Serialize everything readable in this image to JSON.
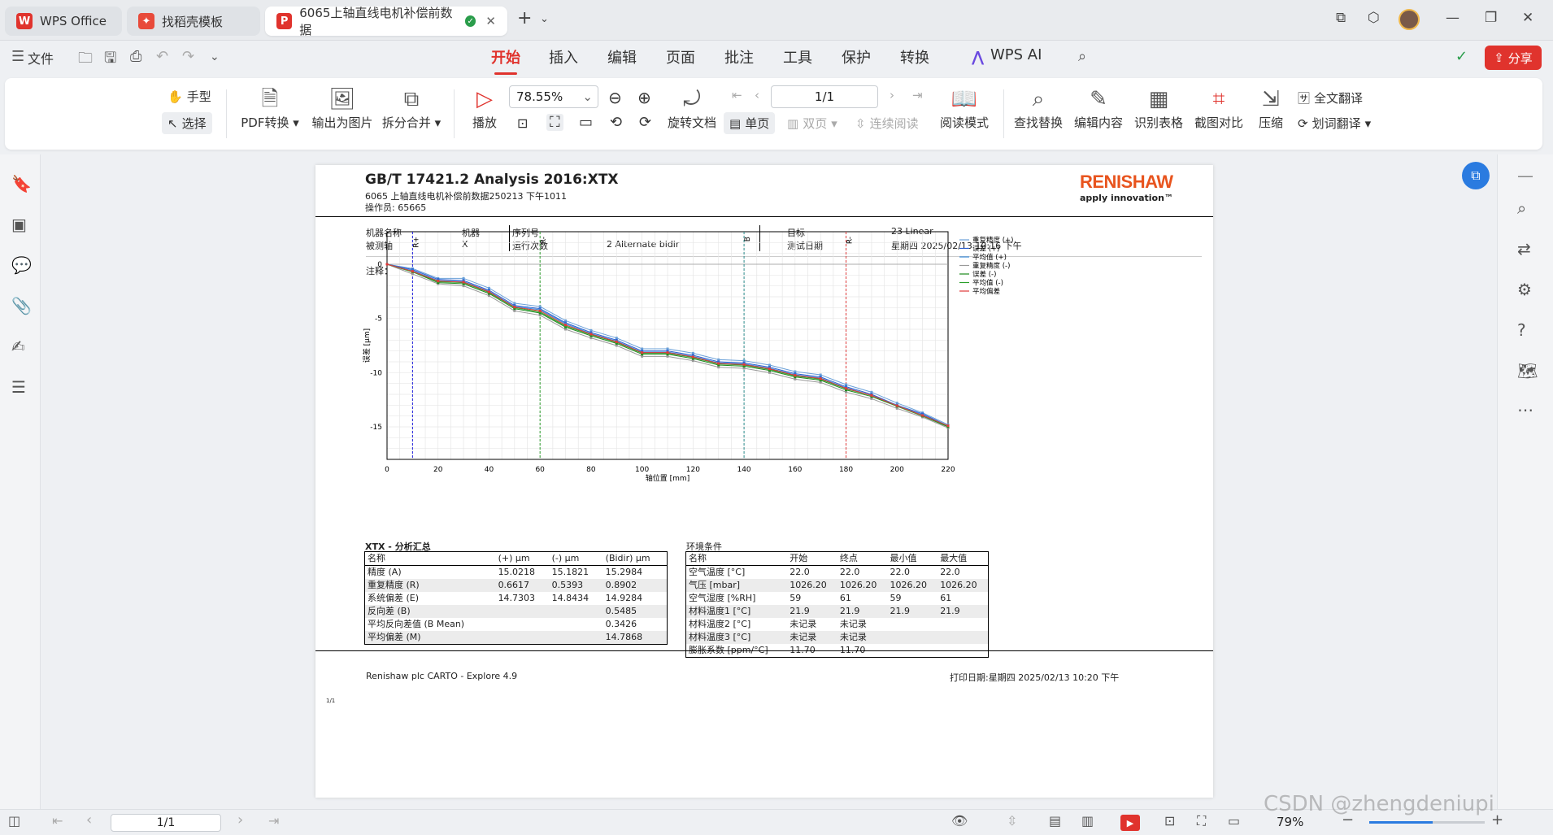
{
  "tabs": [
    {
      "label": "WPS Office",
      "icon": "wps-logo-icon"
    },
    {
      "label": "找稻壳模板",
      "icon": "docer-icon"
    },
    {
      "label": "6065上轴直线电机补偿前数据",
      "icon": "pdf-icon"
    }
  ],
  "menu": {
    "file": "文件",
    "items": [
      "开始",
      "插入",
      "编辑",
      "页面",
      "批注",
      "工具",
      "保护",
      "转换"
    ],
    "active": "开始",
    "wps_ai": "WPS AI",
    "share": "分享"
  },
  "ribbon": {
    "hand": "手型",
    "select": "选择",
    "pdf_convert": "PDF转换",
    "export_image": "输出为图片",
    "split_merge": "拆分合并",
    "play": "播放",
    "zoom": "78.55%",
    "page": "1/1",
    "rotate": "旋转文档",
    "single": "单页",
    "double": "双页",
    "continuous": "连续阅读",
    "reading": "阅读模式",
    "find_replace": "查找替换",
    "edit_content": "编辑内容",
    "recognize_table": "识别表格",
    "screenshot_compare": "截图对比",
    "compress": "压缩",
    "full_translate": "全文翻译",
    "word_translate": "划词翻译"
  },
  "status": {
    "page": "1/1",
    "zoom": "79%",
    "watermark": "CSDN @zhengdeniupi"
  },
  "report": {
    "title": "GB/T 17421.2 Analysis 2016:XTX",
    "sub1": "6065 上轴直线电机补偿前数据250213 下午1011",
    "sub2": "操作员: 65665",
    "brand": "RENISHAW",
    "tagline": "apply innovation™",
    "info": {
      "machine_k": "机器名称",
      "machine_v": "机器",
      "axis_k": "被测轴",
      "axis_v": "X",
      "serial_k": "序列号",
      "serial_v": "-",
      "runs_k": "运行次数",
      "runs_v": "2 Alternate bidir",
      "target_k": "目标",
      "target_v": "23 Linear",
      "date_k": "测试日期",
      "date_v": "星期四 2025/02/13 10:16 下午"
    },
    "notes": "注释：",
    "table1": {
      "title": "XTX - 分析汇总",
      "head": [
        "名称",
        "(+) µm",
        "(-) µm",
        "(Bidir) µm"
      ],
      "rows": [
        [
          "精度 (A)",
          "15.0218",
          "15.1821",
          "15.2984"
        ],
        [
          "重复精度 (R)",
          "0.6617",
          "0.5393",
          "0.8902"
        ],
        [
          "系统偏差 (E)",
          "14.7303",
          "14.8434",
          "14.9284"
        ],
        [
          "反向差 (B)",
          "",
          "",
          "0.5485"
        ],
        [
          "平均反向差值 (B Mean)",
          "",
          "",
          "0.3426"
        ],
        [
          "平均偏差 (M)",
          "",
          "",
          "14.7868"
        ]
      ]
    },
    "table2": {
      "title": "环境条件",
      "head": [
        "名称",
        "开始",
        "终点",
        "最小值",
        "最大值"
      ],
      "rows": [
        [
          "空气温度 [°C]",
          "22.0",
          "22.0",
          "22.0",
          "22.0"
        ],
        [
          "气压 [mbar]",
          "1026.20",
          "1026.20",
          "1026.20",
          "1026.20"
        ],
        [
          "空气湿度 [%RH]",
          "59",
          "61",
          "59",
          "61"
        ],
        [
          "材料温度1 [°C]",
          "21.9",
          "21.9",
          "21.9",
          "21.9"
        ],
        [
          "材料温度2 [°C]",
          "未记录",
          "未记录",
          "",
          ""
        ],
        [
          "材料温度3 [°C]",
          "未记录",
          "未记录",
          "",
          ""
        ],
        [
          "膨胀系数 [ppm/°C]",
          "11.70",
          "11.70",
          "",
          ""
        ]
      ]
    },
    "footer_left": "Renishaw plc CARTO - Explore 4.9",
    "footer_right": "打印日期:星期四 2025/02/13 10:20 下午",
    "page_no": "1/1"
  },
  "chart_data": {
    "type": "line",
    "xlabel": "轴位置 [mm]",
    "ylabel": "误差 [µm]",
    "xlim": [
      0,
      220
    ],
    "ylim": [
      -18,
      3
    ],
    "xticks": [
      0,
      20,
      40,
      60,
      80,
      100,
      120,
      140,
      160,
      180,
      200,
      220
    ],
    "yticks": [
      0,
      -5,
      -10,
      -15
    ],
    "x": [
      0,
      10,
      20,
      30,
      40,
      50,
      60,
      70,
      80,
      90,
      100,
      110,
      120,
      130,
      140,
      150,
      160,
      170,
      180,
      190,
      200,
      210,
      220
    ],
    "markers": [
      {
        "label": "R+",
        "x": 10,
        "color": "#1a1adc"
      },
      {
        "label": "R-",
        "x": 60,
        "color": "#2a9a2a"
      },
      {
        "label": "B",
        "x": 140,
        "color": "#2a8a8a"
      },
      {
        "label": "R-",
        "x": 180,
        "color": "#e03a3a"
      }
    ],
    "series": [
      {
        "name": "重复精度 (+)",
        "color": "#6aa0d8",
        "values": [
          0,
          -0.4,
          -1.3,
          -1.3,
          -2.2,
          -3.6,
          -3.9,
          -5.2,
          -6.1,
          -6.8,
          -7.8,
          -7.8,
          -8.2,
          -8.8,
          -8.9,
          -9.3,
          -9.9,
          -10.2,
          -11.1,
          -11.8,
          -12.8,
          -13.7,
          -14.8
        ]
      },
      {
        "name": "误差 (+)",
        "color": "#2a5fd0",
        "values": [
          0,
          -0.5,
          -1.4,
          -1.5,
          -2.4,
          -3.8,
          -4.1,
          -5.4,
          -6.3,
          -7.0,
          -8.0,
          -8.0,
          -8.4,
          -9.0,
          -9.1,
          -9.5,
          -10.1,
          -10.4,
          -11.3,
          -12.0,
          -13.0,
          -13.8,
          -14.9
        ]
      },
      {
        "name": "平均值 (+)",
        "color": "#3a8ad8",
        "values": [
          0,
          -0.6,
          -1.5,
          -1.6,
          -2.5,
          -3.9,
          -4.2,
          -5.5,
          -6.4,
          -7.1,
          -8.1,
          -8.1,
          -8.5,
          -9.1,
          -9.2,
          -9.6,
          -10.2,
          -10.5,
          -11.4,
          -12.1,
          -13.0,
          -13.9,
          -14.9
        ]
      },
      {
        "name": "重复精度 (-)",
        "color": "#999999",
        "values": [
          0,
          -0.9,
          -1.8,
          -2.0,
          -2.9,
          -4.3,
          -4.7,
          -6.0,
          -6.8,
          -7.5,
          -8.5,
          -8.5,
          -8.9,
          -9.5,
          -9.6,
          -10.0,
          -10.6,
          -10.9,
          -11.8,
          -12.4,
          -13.3,
          -14.1,
          -15.1
        ]
      },
      {
        "name": "误差 (-)",
        "color": "#1a8a1a",
        "values": [
          0,
          -0.7,
          -1.7,
          -1.8,
          -2.7,
          -4.1,
          -4.5,
          -5.8,
          -6.6,
          -7.3,
          -8.3,
          -8.3,
          -8.7,
          -9.3,
          -9.4,
          -9.8,
          -10.4,
          -10.7,
          -11.6,
          -12.2,
          -13.1,
          -14.0,
          -15.0
        ]
      },
      {
        "name": "平均值 (-)",
        "color": "#2aa02a",
        "values": [
          0,
          -0.7,
          -1.6,
          -1.7,
          -2.6,
          -4.0,
          -4.4,
          -5.7,
          -6.5,
          -7.2,
          -8.2,
          -8.2,
          -8.6,
          -9.2,
          -9.3,
          -9.7,
          -10.3,
          -10.6,
          -11.5,
          -12.1,
          -13.1,
          -14.0,
          -14.9
        ]
      },
      {
        "name": "平均偏差",
        "color": "#e03a3a",
        "values": [
          0,
          -0.65,
          -1.55,
          -1.65,
          -2.55,
          -3.95,
          -4.3,
          -5.6,
          -6.45,
          -7.15,
          -8.15,
          -8.15,
          -8.55,
          -9.15,
          -9.25,
          -9.65,
          -10.25,
          -10.55,
          -11.45,
          -12.1,
          -13.05,
          -13.95,
          -14.9
        ]
      }
    ]
  }
}
